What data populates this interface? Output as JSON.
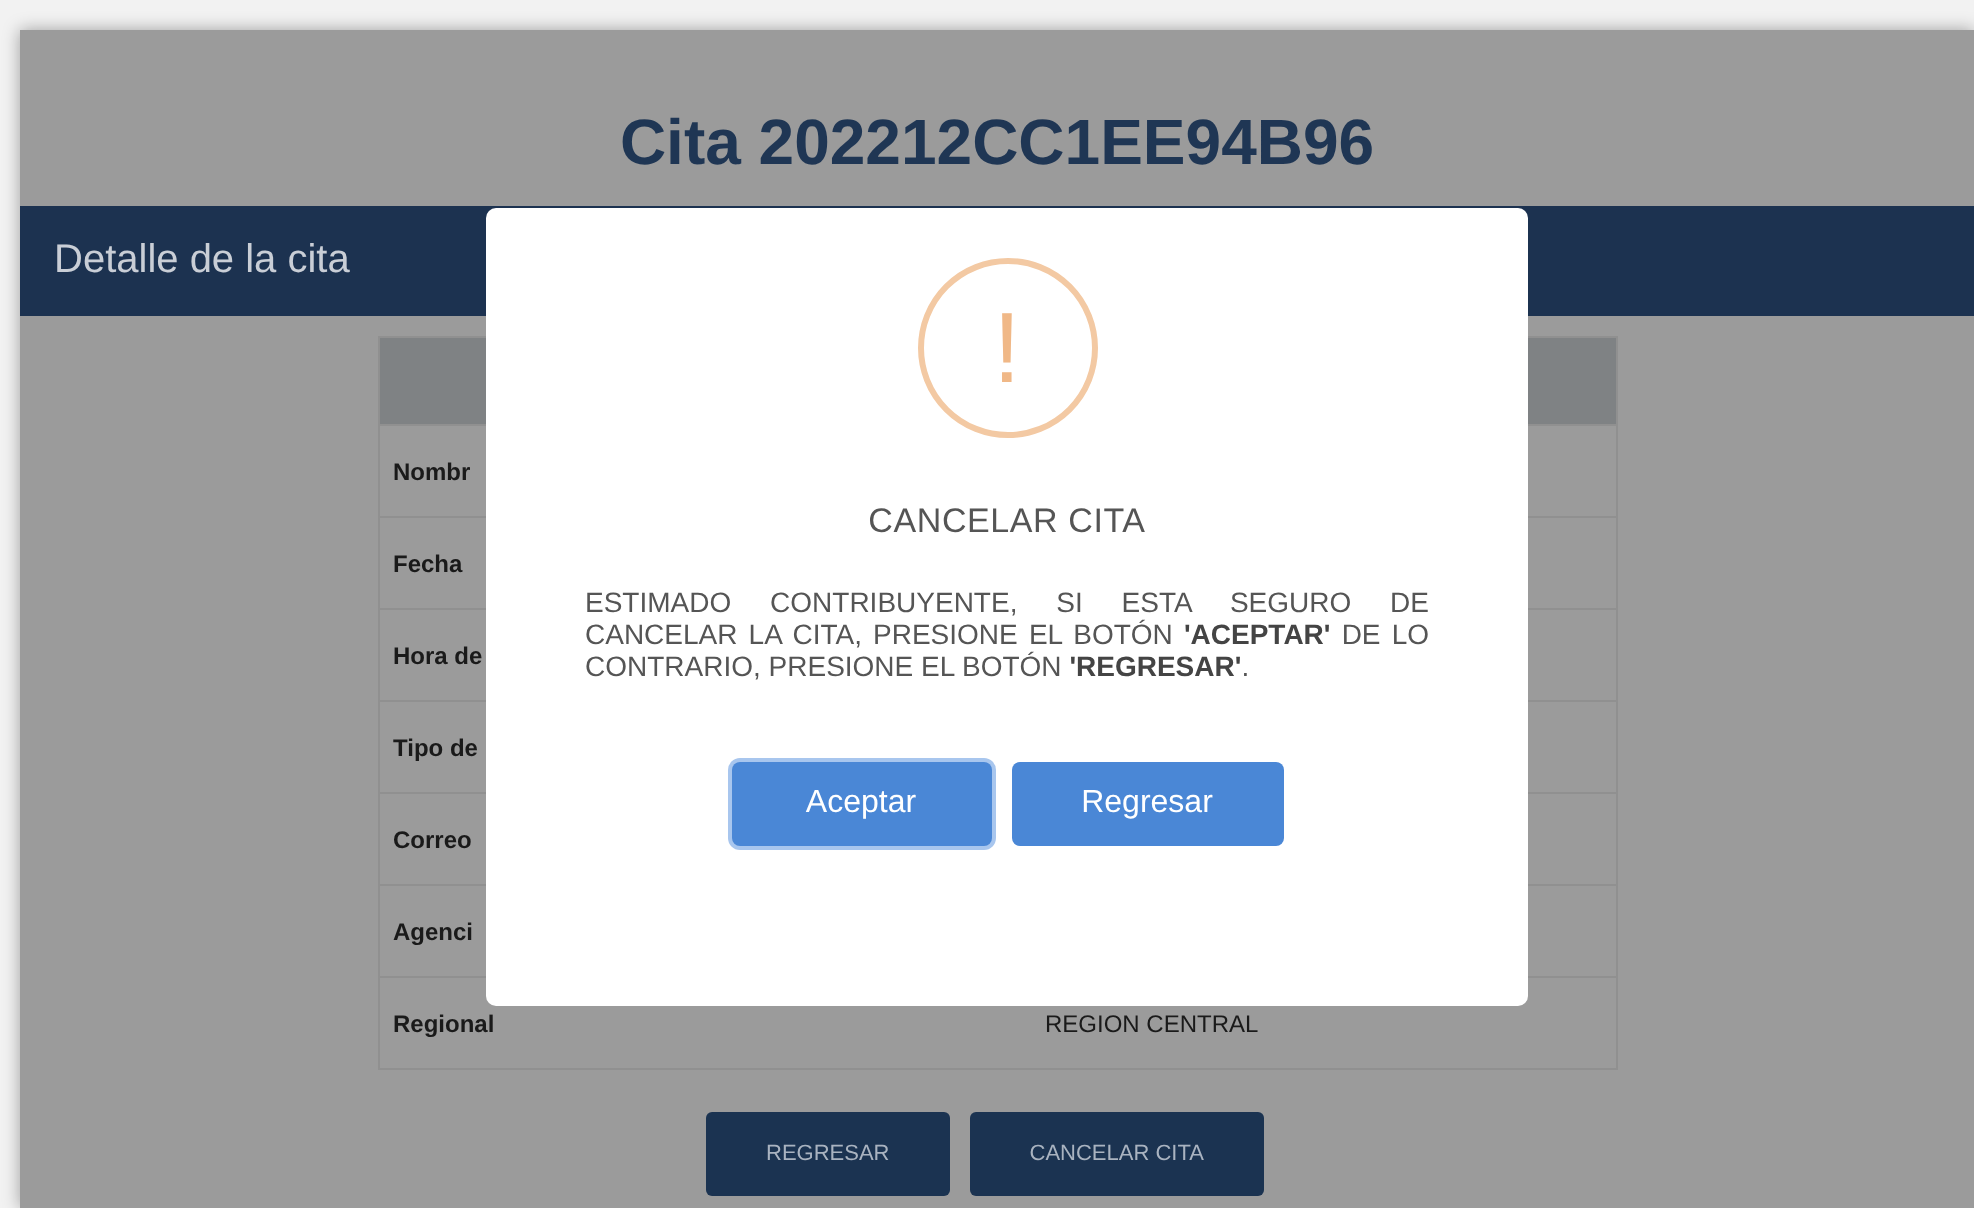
{
  "title": "Cita 202212CC1EE94B96",
  "section": {
    "title": "Detalle de la cita"
  },
  "table": {
    "rows": [
      {
        "label": "Nombr",
        "value": ""
      },
      {
        "label": "Fecha",
        "value": ""
      },
      {
        "label": "Hora de",
        "value": ""
      },
      {
        "label": "Tipo de",
        "value": ""
      },
      {
        "label": "Correo",
        "value": ""
      },
      {
        "label": "Agenci",
        "value": ""
      },
      {
        "label": "Regional",
        "value": "REGION CENTRAL"
      }
    ]
  },
  "buttons": [
    {
      "label": "REGRESAR"
    },
    {
      "label": "CANCELAR CITA"
    }
  ],
  "dialog": {
    "icon": "!",
    "title": "CANCELAR CITA",
    "message": "ESTIMADO CONTRIBUYENTE, SI ESTA SEGURO DE CANCELAR LA CITA, PRESIONE EL BOTÓN **'ACEPTAR'** DE LO CONTRARIO, PRESIONE EL BOTÓN **'REGRESAR'**.",
    "buttons": [
      {
        "label": "Aceptar",
        "focused": true
      },
      {
        "label": "Regresar",
        "focused": false
      }
    ]
  }
}
